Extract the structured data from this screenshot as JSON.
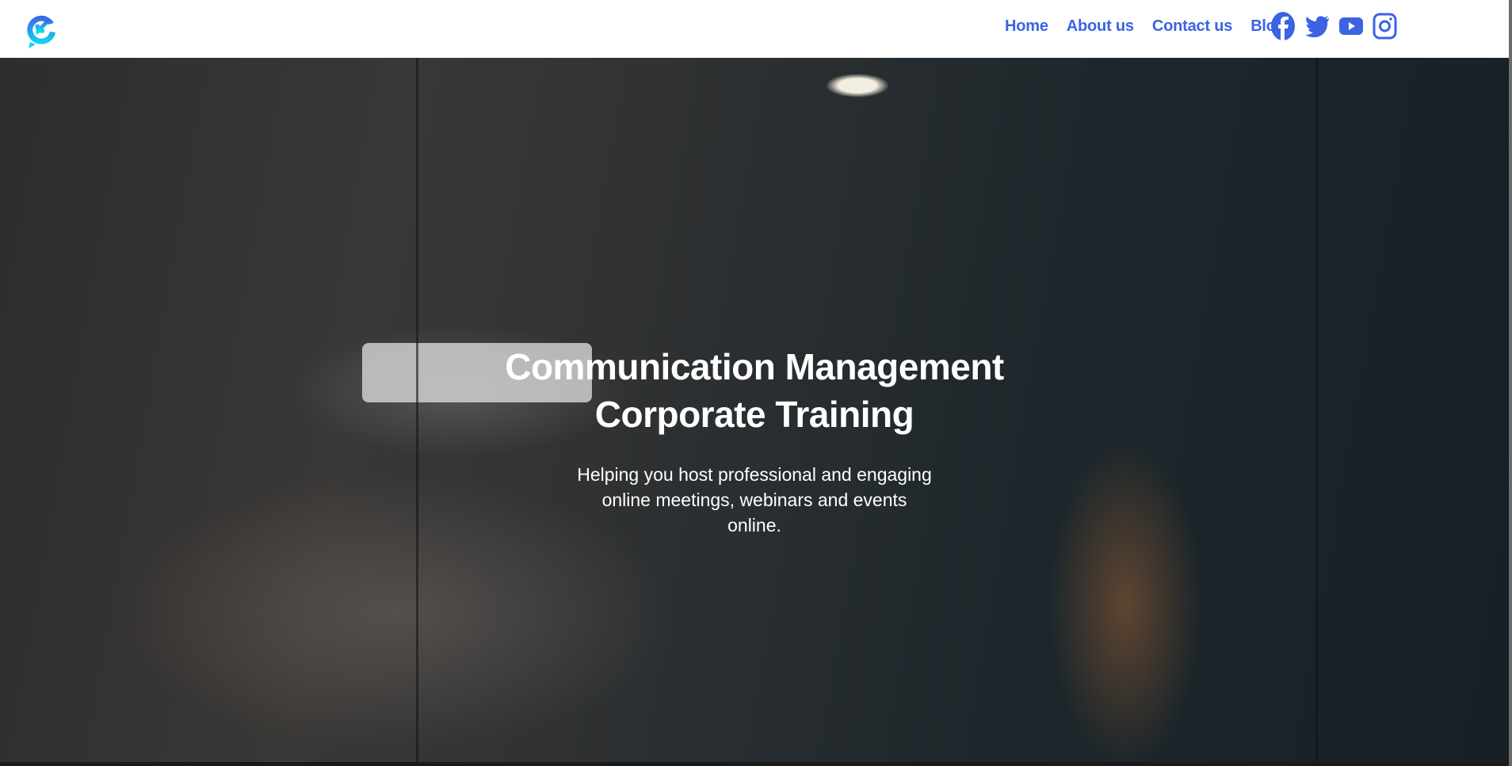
{
  "brand": {
    "logo": "circular-arrow-chat-logo",
    "accent": "#3b63e4"
  },
  "nav": {
    "items": [
      {
        "label": "Home"
      },
      {
        "label": "About us"
      },
      {
        "label": "Contact us"
      },
      {
        "label": "Blog"
      }
    ]
  },
  "social": [
    "facebook-icon",
    "twitter-icon",
    "youtube-icon",
    "instagram-icon"
  ],
  "hero": {
    "title_line1": "Communication Management",
    "title_line2": "Corporate Training",
    "subtitle_line1": "Helping you host professional and engaging",
    "subtitle_line2": "online meetings, webinars and events",
    "subtitle_line3": "online."
  }
}
